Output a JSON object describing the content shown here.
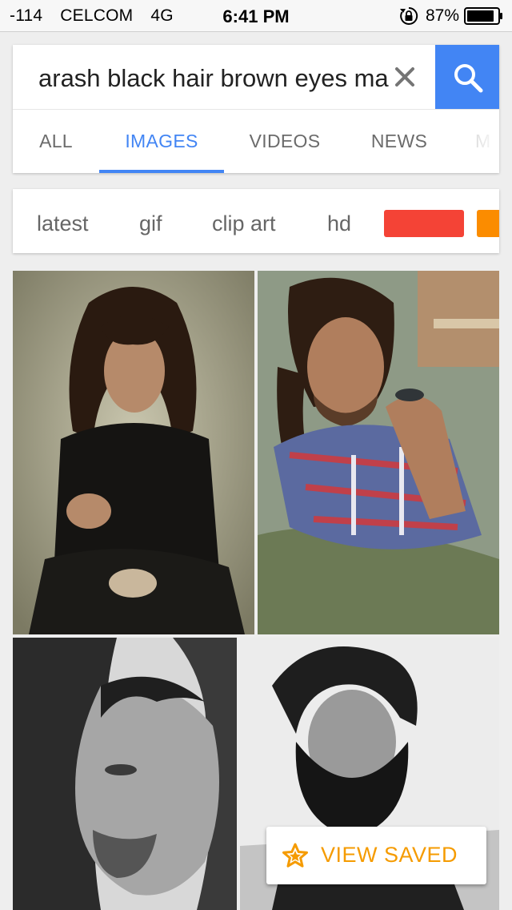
{
  "status_bar": {
    "signal": "-114",
    "carrier": "CELCOM",
    "network": "4G",
    "time": "6:41 PM",
    "battery": "87%"
  },
  "search": {
    "query": "arash black hair brown eyes ma",
    "clear_icon": "close-icon",
    "button_icon": "search-icon"
  },
  "tabs": [
    {
      "label": "ALL",
      "active": false
    },
    {
      "label": "IMAGES",
      "active": true
    },
    {
      "label": "VIDEOS",
      "active": false
    },
    {
      "label": "NEWS",
      "active": false
    },
    {
      "label": "M",
      "active": false
    }
  ],
  "filter_chips": [
    "latest",
    "gif",
    "clip art",
    "hd"
  ],
  "color_chips": [
    "#f44336",
    "#fb8c00"
  ],
  "images": [
    {
      "description": "Long curly-haired man in black shirt crouching, ripped jeans"
    },
    {
      "description": "Long-haired man in plaid shirt holding sunglasses"
    },
    {
      "description": "Black and white profile portrait of long-haired man"
    },
    {
      "description": "Black and white portrait of bearded man with curly hair"
    }
  ],
  "view_saved": {
    "label": "VIEW SAVED",
    "icon": "star-icon",
    "accent": "#f59b00"
  },
  "colors": {
    "accent_blue": "#4285f4",
    "background": "#eeeeee"
  }
}
